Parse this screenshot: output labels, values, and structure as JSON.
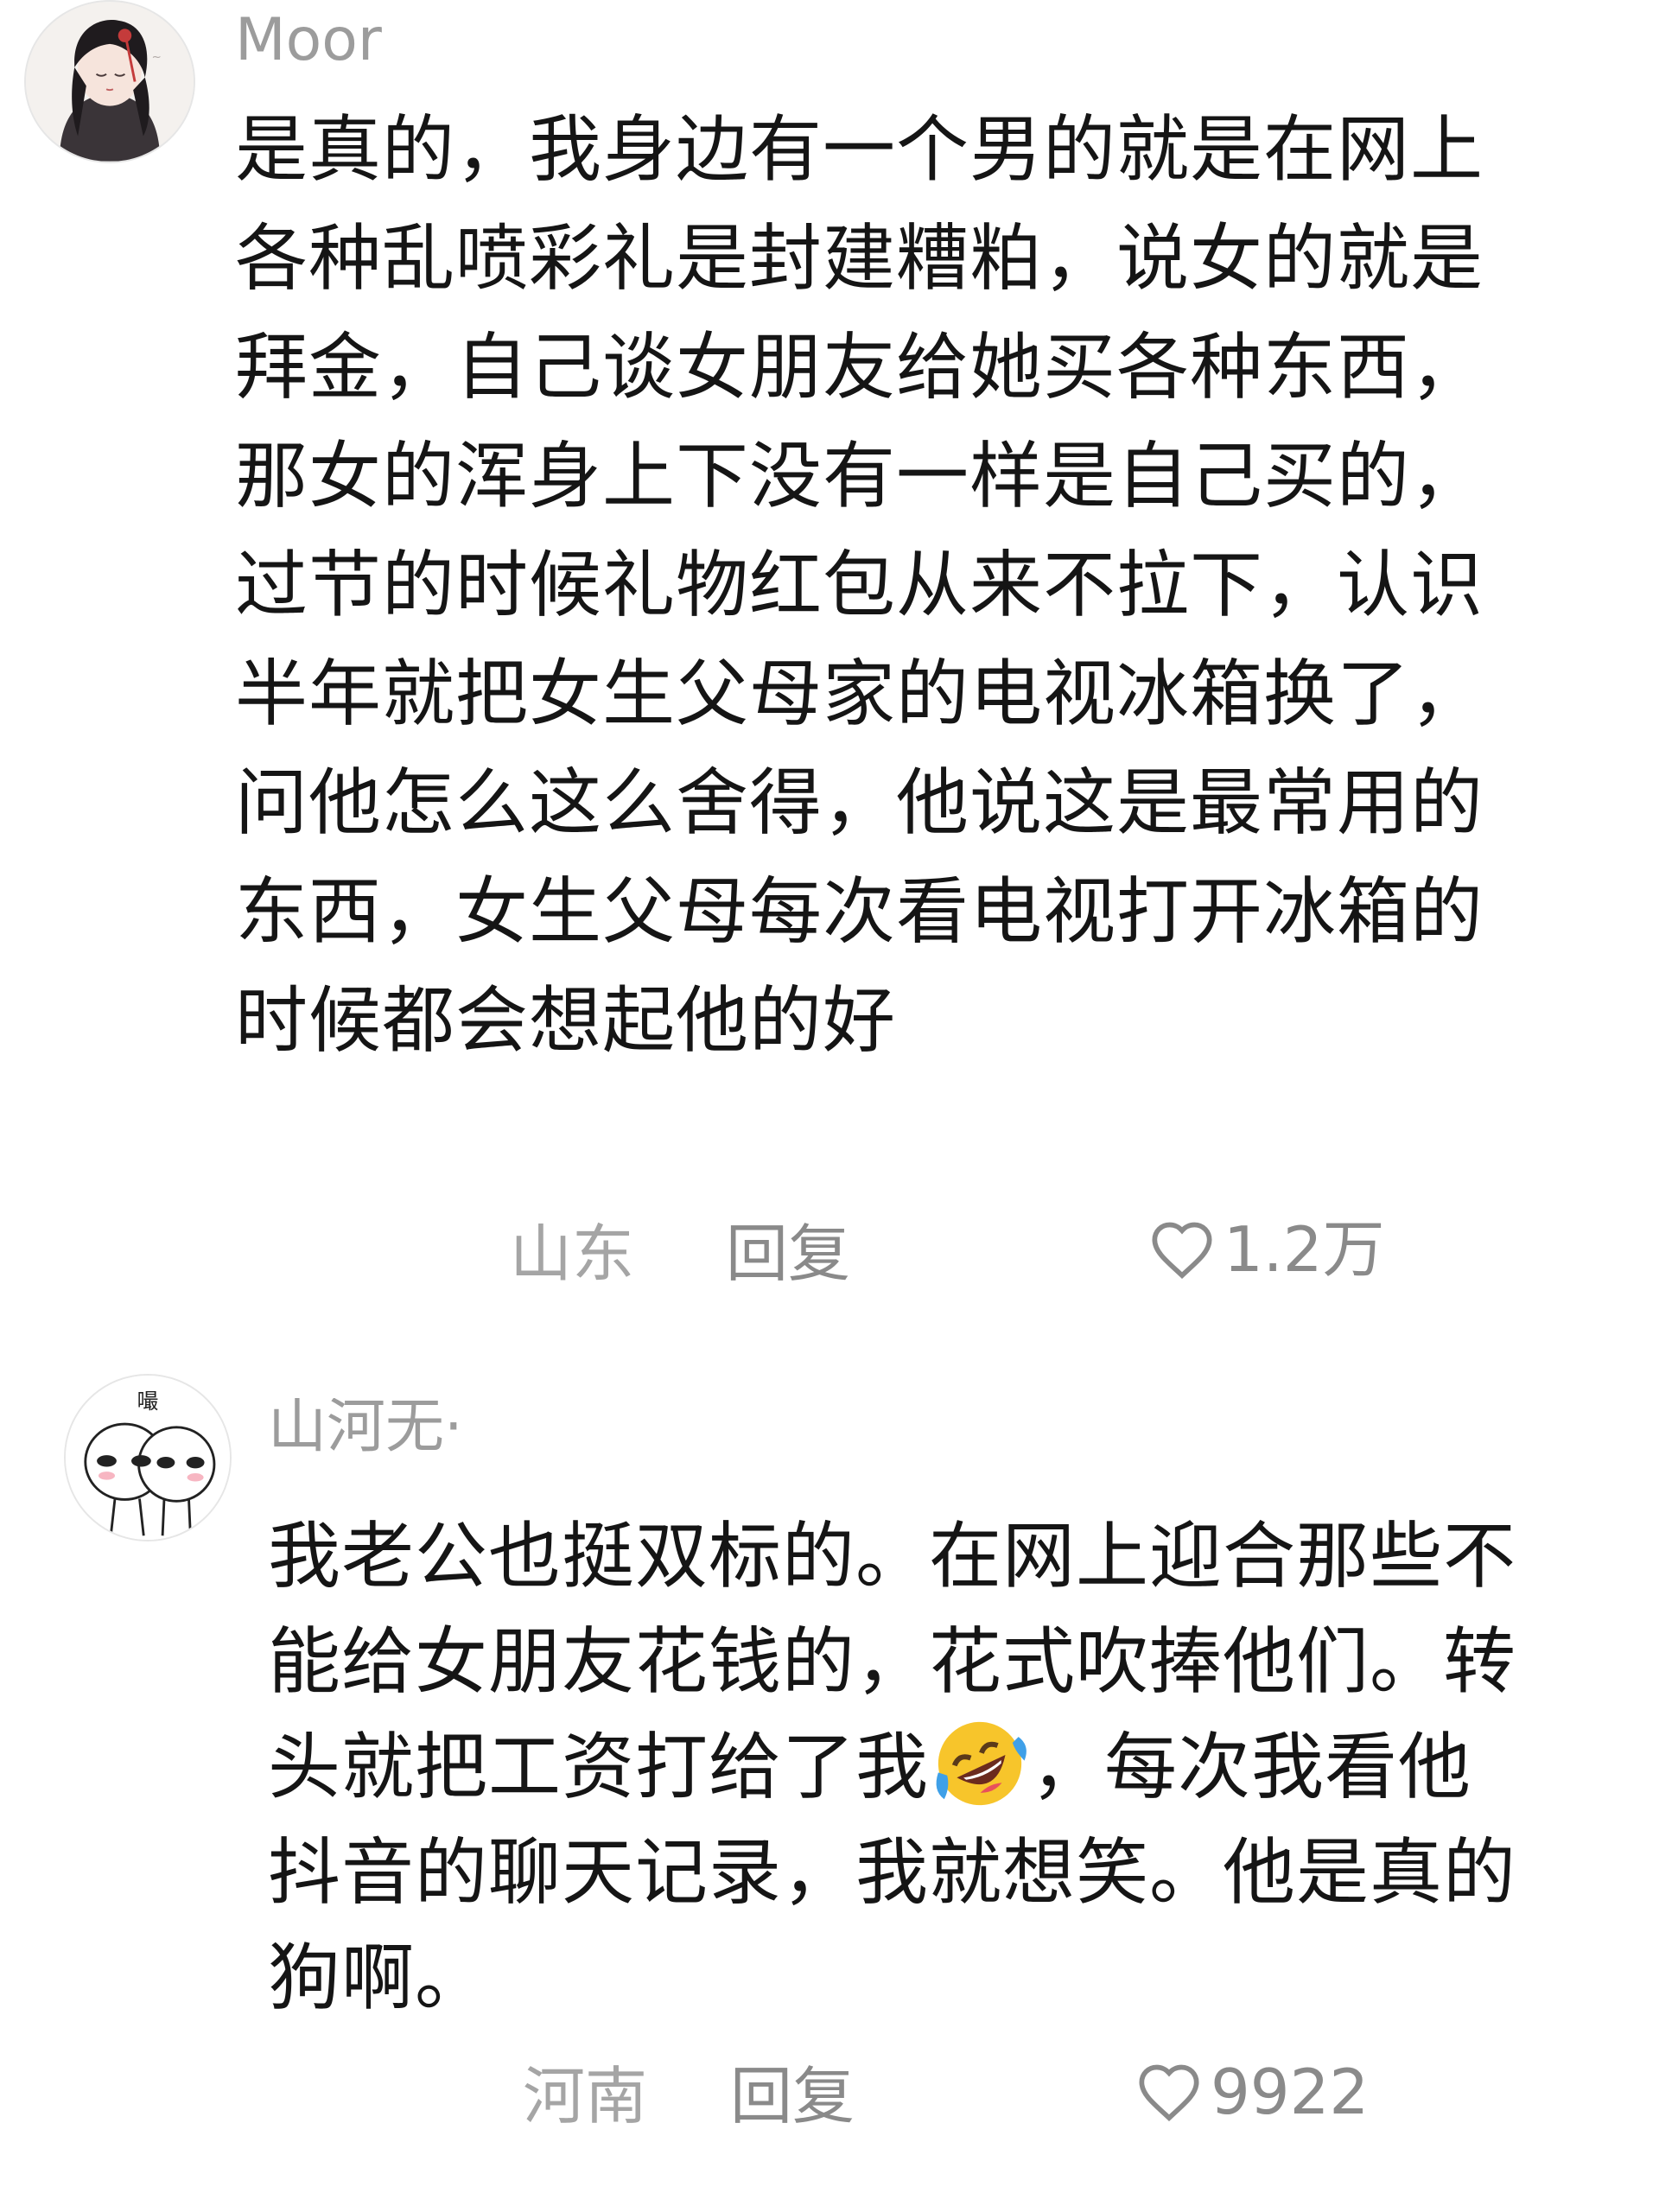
{
  "comments": [
    {
      "username": "Moor",
      "text": "是真的，我身边有一个男的就是在网上各种乱喷彩礼是封建糟粕，说女的就是拜金，自己谈女朋友给她买各种东西，那女的浑身上下没有一样是自己买的，过节的时候礼物红包从来不拉下，认识半年就把女生父母家的电视冰箱换了，问他怎么这么舍得，他说这是最常用的东西，女生父母每次看电视打开冰箱的时候都会想起他的好",
      "region": "山东",
      "reply_label": "回复",
      "likes": "1.2万",
      "avatar_icon": "anime-girl-avatar"
    },
    {
      "username": "山河无·",
      "text_part1": "我老公也挺双标的。在网上迎合那些不能给女朋友花钱的，花式吹捧他们。转头就把工资打给了我",
      "emoji": "rolling-on-floor-laughing-emoji",
      "text_part2": "，每次我看他抖音的聊天记录，我就想笑。他是真的狗啊。",
      "region": "河南",
      "reply_label": "回复",
      "likes": "9922",
      "avatar_icon": "cartoon-faces-avatar",
      "avatar_caption": "嘬"
    }
  ],
  "colors": {
    "text": "#151515",
    "username": "#9c9c9c",
    "meta": "#8a8a8a",
    "region": "#a5a5a5",
    "emoji": "#f7c52b"
  }
}
